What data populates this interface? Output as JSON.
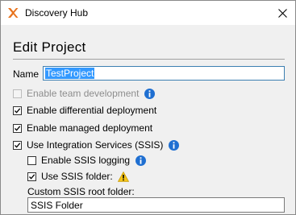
{
  "window": {
    "title": "Discovery Hub",
    "close_glyph": "✕",
    "app_icon": "discovery-hub-x-logo",
    "accent_color": "#e8731d"
  },
  "heading": "Edit Project",
  "name_field": {
    "label": "Name",
    "value": "TestProject"
  },
  "options": [
    {
      "label": "Enable team development",
      "checked": false,
      "enabled": false,
      "icon": "info-icon"
    },
    {
      "label": "Enable differential deployment",
      "checked": true,
      "enabled": true,
      "icon": ""
    },
    {
      "label": "Enable managed deployment",
      "checked": true,
      "enabled": true,
      "icon": ""
    },
    {
      "label": "Use Integration Services (SSIS)",
      "checked": true,
      "enabled": true,
      "icon": "info-icon"
    }
  ],
  "ssis": {
    "logging": {
      "label": "Enable SSIS logging",
      "checked": false,
      "icon": "info-icon"
    },
    "use_folder": {
      "label": "Use SSIS folder:",
      "checked": true,
      "icon": "warning-icon"
    },
    "root_label": "Custom SSIS root folder:",
    "root_value": "SSIS Folder"
  },
  "colors": {
    "info_blue": "#1f6fd1",
    "warning_yellow": "#f5c518",
    "selection_blue": "#3399ff"
  }
}
